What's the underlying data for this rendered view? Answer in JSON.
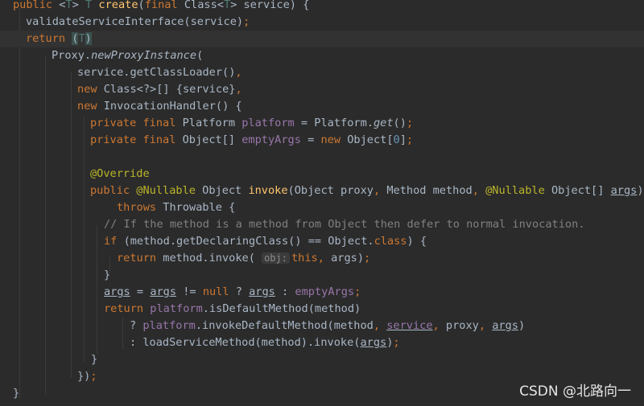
{
  "editor": {
    "lines": [
      [
        [
          "kw",
          "public "
        ],
        [
          "ty",
          "<"
        ],
        [
          "tp",
          "T"
        ],
        [
          "ty",
          "> "
        ],
        [
          "tp",
          "T "
        ],
        [
          "fn",
          "create"
        ],
        [
          "ty",
          "("
        ],
        [
          "kw",
          "final "
        ],
        [
          "ty",
          "Class<"
        ],
        [
          "tp",
          "T"
        ],
        [
          "ty",
          "> service) {"
        ]
      ],
      [
        [
          "ty",
          "validateServiceInterface(service)"
        ],
        [
          "kw",
          ";"
        ]
      ],
      [
        [
          "kw",
          "return "
        ],
        [
          "phl",
          "("
        ],
        [
          "tp",
          "T"
        ],
        [
          "phl",
          ")"
        ]
      ],
      [
        [
          "ty",
          "Proxy."
        ],
        [
          "ital",
          "newProxyInstance"
        ],
        [
          "ty",
          "("
        ]
      ],
      [
        [
          "ty",
          "service.getClassLoader()"
        ],
        [
          "kw",
          ","
        ]
      ],
      [
        [
          "kw",
          "new "
        ],
        [
          "ty",
          "Class<?>[] {service}"
        ],
        [
          "kw",
          ","
        ]
      ],
      [
        [
          "kw",
          "new "
        ],
        [
          "ty",
          "InvocationHandler() {"
        ]
      ],
      [
        [
          "kw",
          "private final "
        ],
        [
          "ty",
          "Platform "
        ],
        [
          "fld",
          "platform "
        ],
        [
          "ty",
          "= Platform."
        ],
        [
          "ital",
          "get"
        ],
        [
          "ty",
          "()"
        ],
        [
          "kw",
          ";"
        ]
      ],
      [
        [
          "kw",
          "private final "
        ],
        [
          "ty",
          "Object[] "
        ],
        [
          "fld",
          "emptyArgs "
        ],
        [
          "ty",
          "= "
        ],
        [
          "kw",
          "new "
        ],
        [
          "ty",
          "Object["
        ],
        [
          "num",
          "0"
        ],
        [
          "ty",
          "]"
        ],
        [
          "kw",
          ";"
        ]
      ],
      [],
      [
        [
          "ann",
          "@Override"
        ]
      ],
      [
        [
          "kw",
          "public "
        ],
        [
          "ann",
          "@Nullable "
        ],
        [
          "ty",
          "Object "
        ],
        [
          "fn",
          "invoke"
        ],
        [
          "ty",
          "(Object proxy"
        ],
        [
          "kw",
          ", "
        ],
        [
          "ty",
          "Method method"
        ],
        [
          "kw",
          ", "
        ],
        [
          "ann",
          "@Nullable "
        ],
        [
          "ty",
          "Object[] "
        ],
        [
          "ul",
          "args"
        ],
        [
          "ty",
          ")"
        ]
      ],
      [
        [
          "kw",
          "throws "
        ],
        [
          "ty",
          "Throwable {"
        ]
      ],
      [
        [
          "cmt",
          "// If the method is a method from Object then defer to normal invocation."
        ]
      ],
      [
        [
          "kw",
          "if "
        ],
        [
          "ty",
          "(method.getDeclaringClass() == Object."
        ],
        [
          "kw",
          "class"
        ],
        [
          "ty",
          ") {"
        ]
      ],
      [
        [
          "kw",
          "return "
        ],
        [
          "ty",
          "method.invoke( "
        ],
        [
          "hint",
          "obj:"
        ],
        [
          "kw",
          "this"
        ],
        [
          "kw",
          ", "
        ],
        [
          "ty",
          "args)"
        ],
        [
          "kw",
          ";"
        ]
      ],
      [
        [
          "ty",
          "}"
        ]
      ],
      [
        [
          "ul",
          "args"
        ],
        [
          "ty",
          " = "
        ],
        [
          "ul",
          "args"
        ],
        [
          "ty",
          " != "
        ],
        [
          "kw",
          "null "
        ],
        [
          "ty",
          "? "
        ],
        [
          "ul",
          "args"
        ],
        [
          "ty",
          " : "
        ],
        [
          "fld",
          "emptyArgs"
        ],
        [
          "kw",
          ";"
        ]
      ],
      [
        [
          "kw",
          "return "
        ],
        [
          "fld",
          "platform"
        ],
        [
          "ty",
          ".isDefaultMethod(method)"
        ]
      ],
      [
        [
          "ty",
          "? "
        ],
        [
          "fld",
          "platform"
        ],
        [
          "ty",
          ".invokeDefaultMethod(method"
        ],
        [
          "kw",
          ", "
        ],
        [
          "fldu",
          "service"
        ],
        [
          "kw",
          ", "
        ],
        [
          "ty",
          "proxy"
        ],
        [
          "kw",
          ", "
        ],
        [
          "ul",
          "args"
        ],
        [
          "ty",
          ")"
        ]
      ],
      [
        [
          "ty",
          ": loadServiceMethod(method).invoke("
        ],
        [
          "ul",
          "args"
        ],
        [
          "ty",
          ")"
        ],
        [
          "kw",
          ";"
        ]
      ],
      [
        [
          "ty",
          "}"
        ]
      ],
      [
        [
          "ty",
          "})"
        ],
        [
          "kw",
          ";"
        ]
      ],
      [
        [
          "ty",
          "}"
        ]
      ]
    ]
  },
  "watermark": "CSDN @北路向一"
}
